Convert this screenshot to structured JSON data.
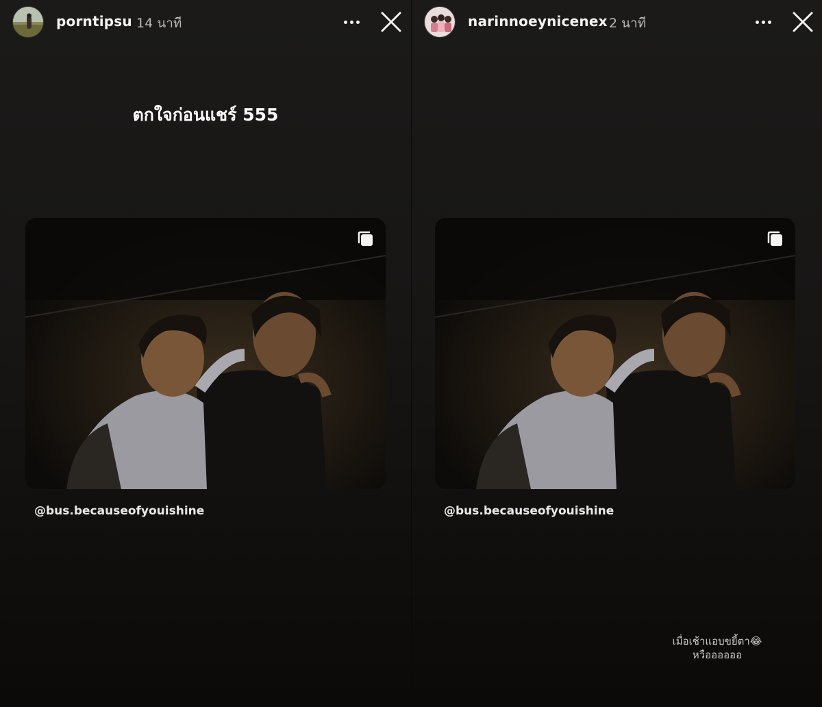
{
  "stories": [
    {
      "username": "porntipsu",
      "time": "14 นาที",
      "caption": "ตกใจก่อนแชร์ 555",
      "mention": "@bus.becauseofyouishine"
    },
    {
      "username": "narinnoeynicenex",
      "time": "2 นาที",
      "mention": "@bus.becauseofyouishine",
      "sticker_line1": "เมื่อเช้าแอบขยี้ตา😂",
      "sticker_line2": "หวืออออออ"
    }
  ],
  "icons": {
    "more": "more-horizontal-icon",
    "close": "close-icon",
    "multi_post": "multiple-posts-icon"
  },
  "colors": {
    "background": "#171615",
    "text_primary": "#f4f4f4",
    "text_secondary": "#b9b9b9"
  }
}
